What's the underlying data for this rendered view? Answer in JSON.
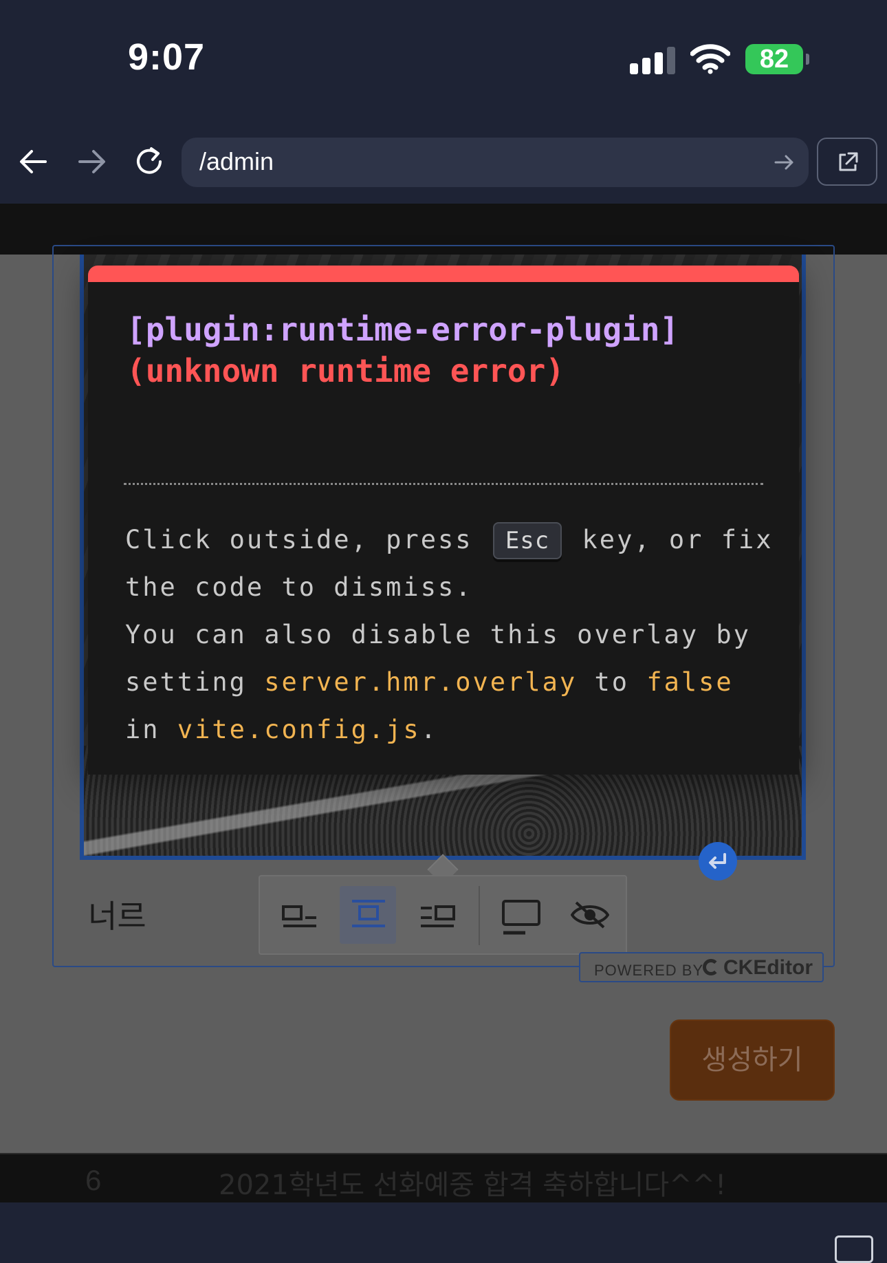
{
  "status_bar": {
    "time": "9:07",
    "battery_level": "82",
    "icons": [
      "cellular-signal-icon",
      "wifi-icon",
      "battery-charging-icon"
    ],
    "battery_color": "#34c759"
  },
  "browser": {
    "url": "/admin",
    "icons": [
      "back-arrow-icon",
      "forward-arrow-icon",
      "reload-icon",
      "go-arrow-icon",
      "open-external-icon"
    ]
  },
  "page": {
    "editor_text": "너르",
    "powered_by_label": "POWERED BY",
    "ckeditor_brand": "CKEditor",
    "create_button_label": "생성하기",
    "table_row": {
      "number": "6",
      "title": "2021학년도 선화예중 합격 축하합니다^^!"
    },
    "image_toolbar": [
      "align-left-icon",
      "align-center-icon",
      "align-right-icon",
      "full-width-icon",
      "hide-icon"
    ]
  },
  "error_overlay": {
    "plugin": "[plugin:runtime-error-plugin]",
    "message": "(unknown runtime error)",
    "tip": {
      "part1": "Click outside, press",
      "esc_key": "Esc",
      "part2": "key, or fix the code to dismiss.",
      "part3": "You can also disable this overlay by setting",
      "config_key": "server.hmr.overlay",
      "part4": "to",
      "false_value": "false",
      "part5": "in",
      "config_file": "vite.config.js",
      "part6": "."
    },
    "accent_color": "#ff5555"
  }
}
